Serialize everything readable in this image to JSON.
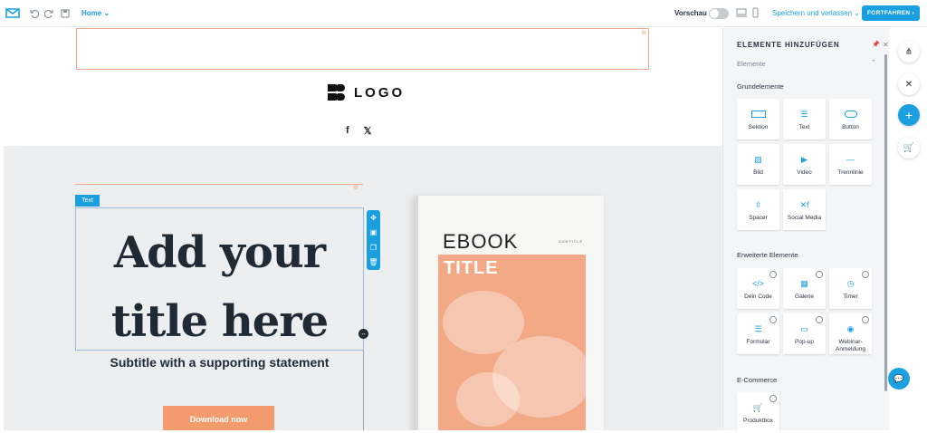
{
  "topbar": {
    "home_label": "Home",
    "preview_label": "Vorschau",
    "save_exit_label": "Speichern und verlassen",
    "continue_label": "FORTFAHREN"
  },
  "canvas": {
    "logo_text": "LOGO",
    "social": [
      "f",
      "𝕏"
    ],
    "text_tag": "Text",
    "title_line1": "Add your",
    "title_line2": "title here",
    "subtitle": "Subtitle with a supporting statement",
    "download_button": "Download now",
    "ebook": {
      "title": "EBOOK",
      "subtitle": "SUBTITLE",
      "cover_title": "TITLE"
    }
  },
  "panel": {
    "title": "ELEMENTE HINZUFÜGEN",
    "dropdown": "Elemente",
    "basic_label": "Grundelemente",
    "basic": [
      {
        "label": "Sektion",
        "icon": "section-icon"
      },
      {
        "label": "Text",
        "icon": "text-icon"
      },
      {
        "label": "Button",
        "icon": "button-icon"
      },
      {
        "label": "Bild",
        "icon": "image-icon"
      },
      {
        "label": "Video",
        "icon": "video-icon"
      },
      {
        "label": "Trennlinie",
        "icon": "divider-icon"
      },
      {
        "label": "Spacer",
        "icon": "spacer-icon"
      },
      {
        "label": "Social Media",
        "icon": "social-media-icon"
      }
    ],
    "advanced_label": "Erweiterte Elemente",
    "advanced": [
      {
        "label": "Dein Code",
        "icon": "code-icon"
      },
      {
        "label": "Galerie",
        "icon": "gallery-icon"
      },
      {
        "label": "Timer",
        "icon": "timer-icon"
      },
      {
        "label": "Formular",
        "icon": "form-icon"
      },
      {
        "label": "Pop-up",
        "icon": "popup-icon"
      },
      {
        "label": "Webinar-\nAnmeldung",
        "icon": "webinar-icon"
      }
    ],
    "ecommerce_label": "E-Commerce",
    "ecommerce": [
      {
        "label": "Produktbox",
        "icon": "cart-icon"
      }
    ]
  },
  "colors": {
    "accent": "#1a9fe0",
    "cta_orange": "#f39b6d",
    "selection": "#f1a98a"
  }
}
